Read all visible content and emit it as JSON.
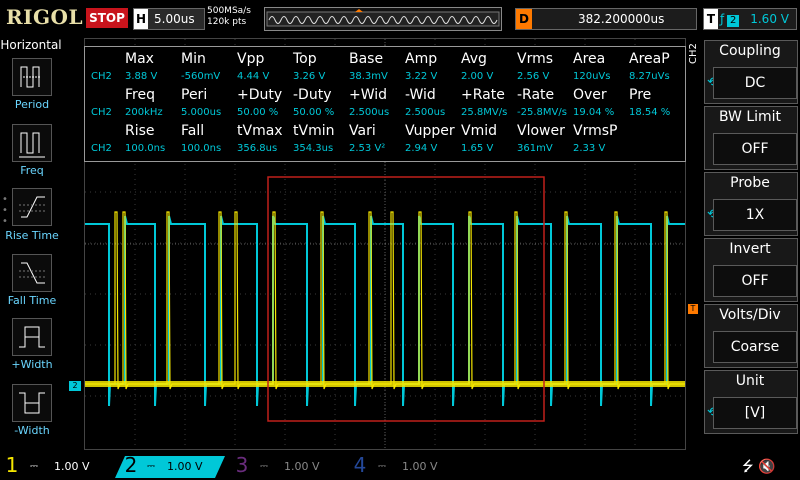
{
  "top": {
    "logo": "RIGOL",
    "status": "STOP",
    "h_key": "H",
    "timebase": "5.00us",
    "sample_rate": "500MSa/s",
    "memory": "120k pts",
    "delay_key": "D",
    "delay": "382.200000us",
    "trig_key": "T",
    "trig_source": "2",
    "trig_level": "1.60 V"
  },
  "left": {
    "title": "Horizontal",
    "items": [
      {
        "label": "Period"
      },
      {
        "label": "Freq"
      },
      {
        "label": "Rise Time"
      },
      {
        "label": "Fall Time"
      },
      {
        "label": "+Width"
      },
      {
        "label": "-Width"
      }
    ]
  },
  "meas": {
    "rows": [
      {
        "kind": "h",
        "cells": [
          "Max",
          "Min",
          "Vpp",
          "Top",
          "Base",
          "Amp",
          "Avg",
          "Vrms",
          "Area",
          "AreaP"
        ]
      },
      {
        "kind": "v",
        "cells": [
          "CH2",
          "3.88 V",
          "-560mV",
          "4.44 V",
          "3.26 V",
          "38.3mV",
          "3.22 V",
          "2.00 V",
          "2.56 V",
          "120uVs",
          "8.27uVs"
        ]
      },
      {
        "kind": "h",
        "cells": [
          "Freq",
          "Peri",
          "+Duty",
          "-Duty",
          "+Wid",
          "-Wid",
          "+Rate",
          "-Rate",
          "Over",
          "Pre"
        ]
      },
      {
        "kind": "v",
        "cells": [
          "CH2",
          "200kHz",
          "5.000us",
          "50.00 %",
          "50.00 %",
          "2.500us",
          "2.500us",
          "25.8MV/s",
          "-25.8MV/s",
          "19.04 %",
          "18.54 %"
        ]
      },
      {
        "kind": "h",
        "cells": [
          "Rise",
          "Fall",
          "tVmax",
          "tVmin",
          "Vari",
          "Vupper",
          "Vmid",
          "Vlower",
          "VrmsP"
        ]
      },
      {
        "kind": "v",
        "cells": [
          "CH2",
          "100.0ns",
          "100.0ns",
          "356.8us",
          "354.3us",
          "2.53 V²",
          "2.94 V",
          "1.65 V",
          "361mV",
          "2.33 V"
        ]
      }
    ]
  },
  "right": {
    "side_label": "CH2",
    "items": [
      {
        "title": "Coupling",
        "value": "DC"
      },
      {
        "title": "BW Limit",
        "value": "OFF"
      },
      {
        "title": "Probe",
        "value": "1X"
      },
      {
        "title": "Invert",
        "value": "OFF"
      },
      {
        "title": "Volts/Div",
        "value": "Coarse"
      },
      {
        "title": "Unit",
        "value": "[V]"
      }
    ]
  },
  "channels": [
    {
      "num": "1",
      "scale": "1.00 V",
      "color": "#f5e600"
    },
    {
      "num": "2",
      "scale": "1.00 V",
      "color": "#00c8d8"
    },
    {
      "num": "3",
      "scale": "1.00 V",
      "color": "#b04ad0"
    },
    {
      "num": "4",
      "scale": "1.00 V",
      "color": "#3c78ff"
    }
  ],
  "markers": {
    "ch2": "2",
    "trig": "T"
  }
}
